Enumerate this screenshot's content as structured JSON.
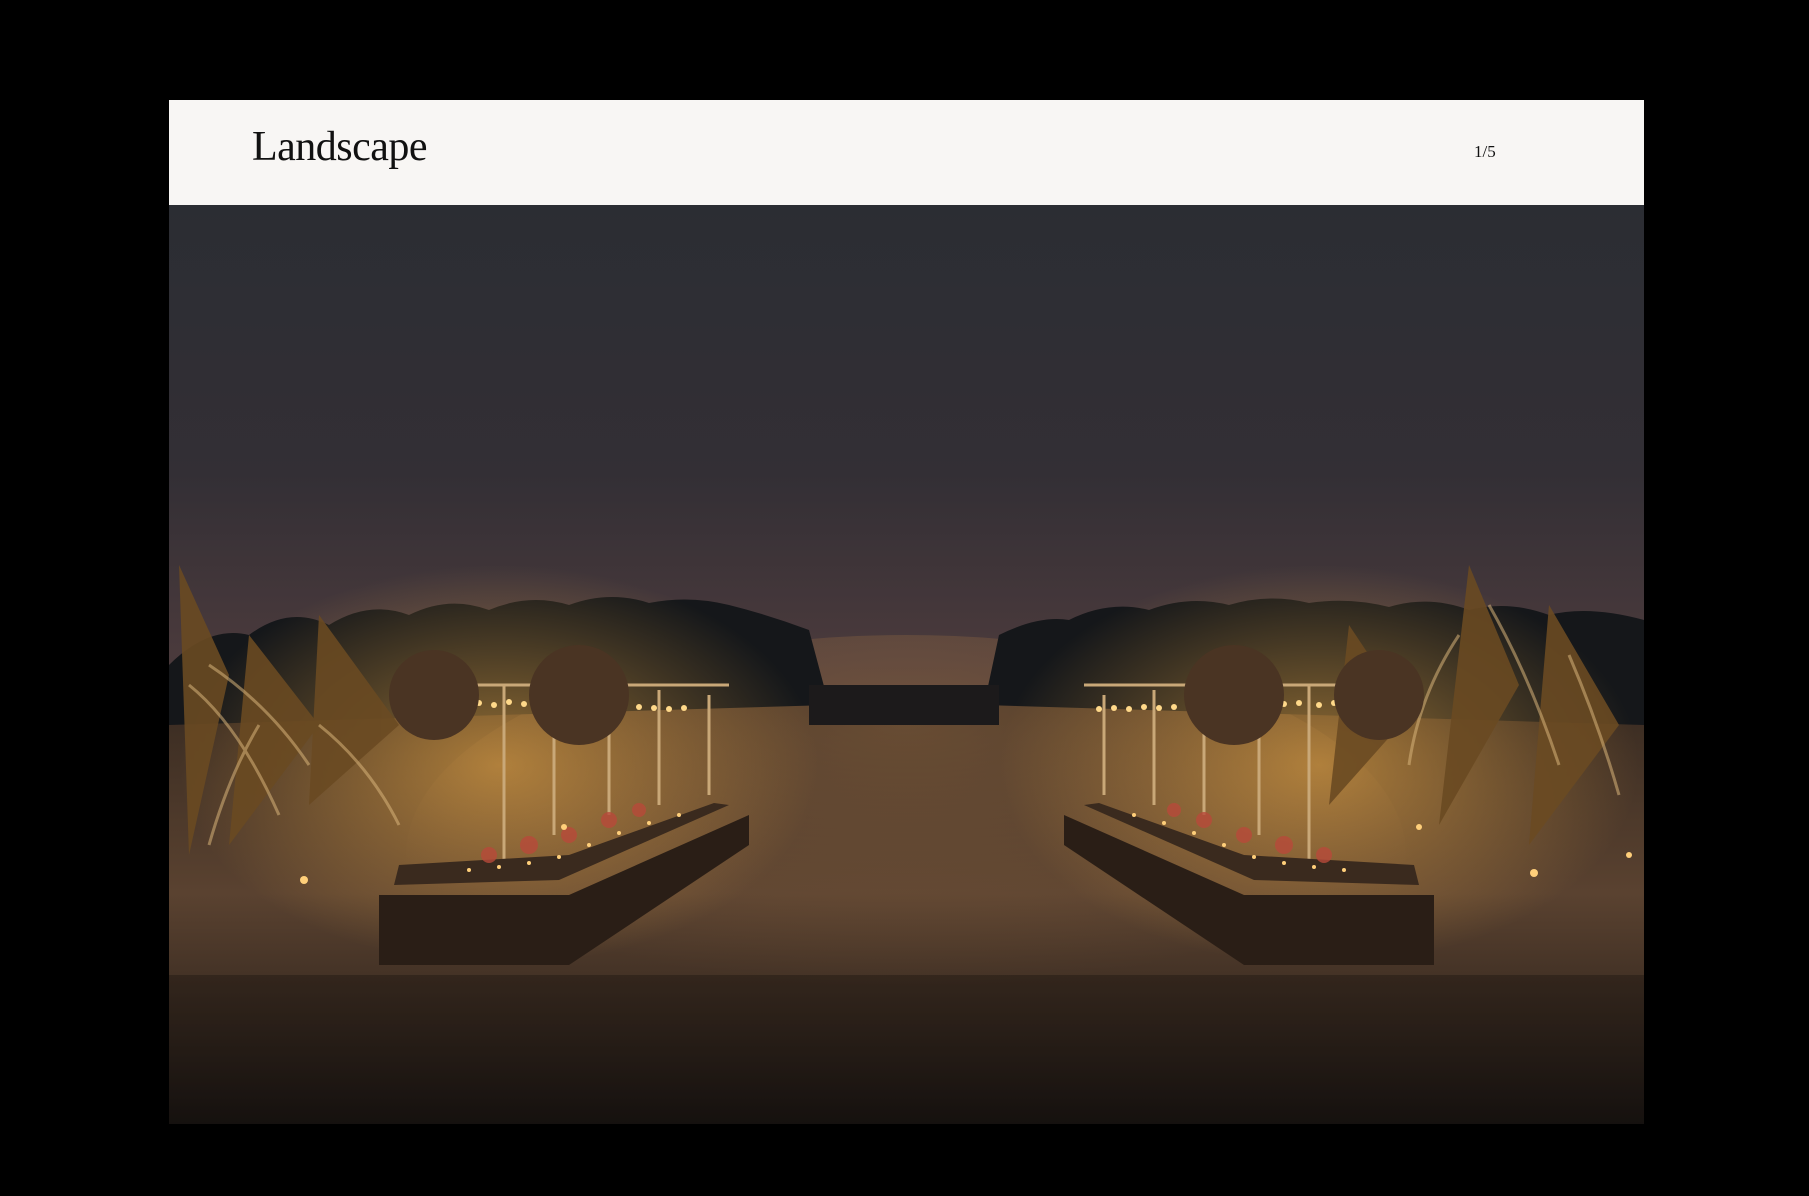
{
  "header": {
    "title": "Landscape",
    "counter": "1/5"
  },
  "photo": {
    "subject": "illuminated-outdoor-dinner-setting-at-dusk",
    "colors": {
      "sky_top": "#2b2d33",
      "sky_bottom": "#4a3a3c",
      "ground": "#3c2d22",
      "lights": "#ffcf7a"
    }
  }
}
